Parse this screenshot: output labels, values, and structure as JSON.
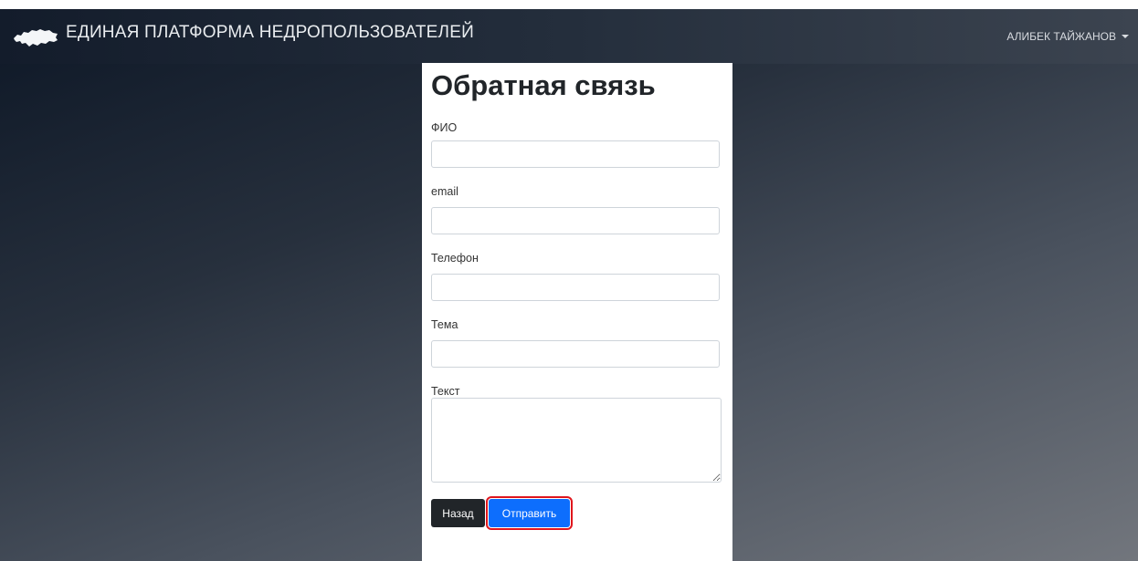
{
  "header": {
    "app_title": "ЕДИНАЯ ПЛАТФОРМА НЕДРОПОЛЬЗОВАТЕЛЕЙ",
    "user_name": "АЛИБЕК ТАЙЖАНОВ",
    "logo_icon": "kazakhstan-map-icon"
  },
  "form": {
    "title": "Обратная связь",
    "fields": [
      {
        "label": "ФИО",
        "value": "",
        "placeholder": ""
      },
      {
        "label": "email",
        "value": "",
        "placeholder": ""
      },
      {
        "label": "Телефон",
        "value": "",
        "placeholder": ""
      },
      {
        "label": "Тема",
        "value": "",
        "placeholder": ""
      },
      {
        "label": "Текст",
        "value": "",
        "placeholder": ""
      }
    ],
    "back_label": "Назад",
    "submit_label": "Отправить"
  },
  "colors": {
    "primary": "#0d6efd",
    "dark": "#212529",
    "highlight": "#e0161d"
  }
}
